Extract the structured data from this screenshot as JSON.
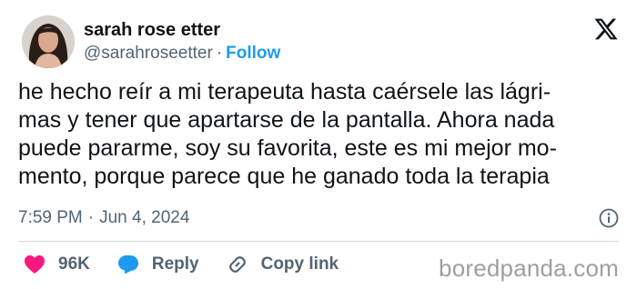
{
  "author": {
    "display_name": "sarah rose etter",
    "handle": "@sarahroseetter",
    "separator": "·",
    "follow_label": "Follow",
    "avatar_icon": "user-avatar-photo"
  },
  "brand_icon": "x-logo-icon",
  "tweet": {
    "text": "he hecho reír a mi terapeuta hasta caérsele las lágri-\nmas y tener que apartarse de la pantalla. Ahora nada\npuede pararme, soy su favorita, este es mi mejor mo-\nmento, porque parece que he ganado toda la terapia",
    "time": "7:59 PM",
    "separator": "·",
    "date": "Jun 4, 2024",
    "info_icon": "info-icon"
  },
  "actions": {
    "likes": {
      "icon": "heart-icon",
      "count": "96K",
      "color": "#f91880"
    },
    "reply": {
      "icon": "reply-bubble-icon",
      "label": "Reply",
      "color": "#1d9bf0"
    },
    "copy_link": {
      "icon": "link-icon",
      "label": "Copy link"
    }
  },
  "watermark": "boredpanda.com",
  "colors": {
    "accent": "#1d9bf0",
    "text": "#0f1419",
    "secondary_text": "#536471",
    "divider": "#cfd9de",
    "like": "#f91880"
  }
}
